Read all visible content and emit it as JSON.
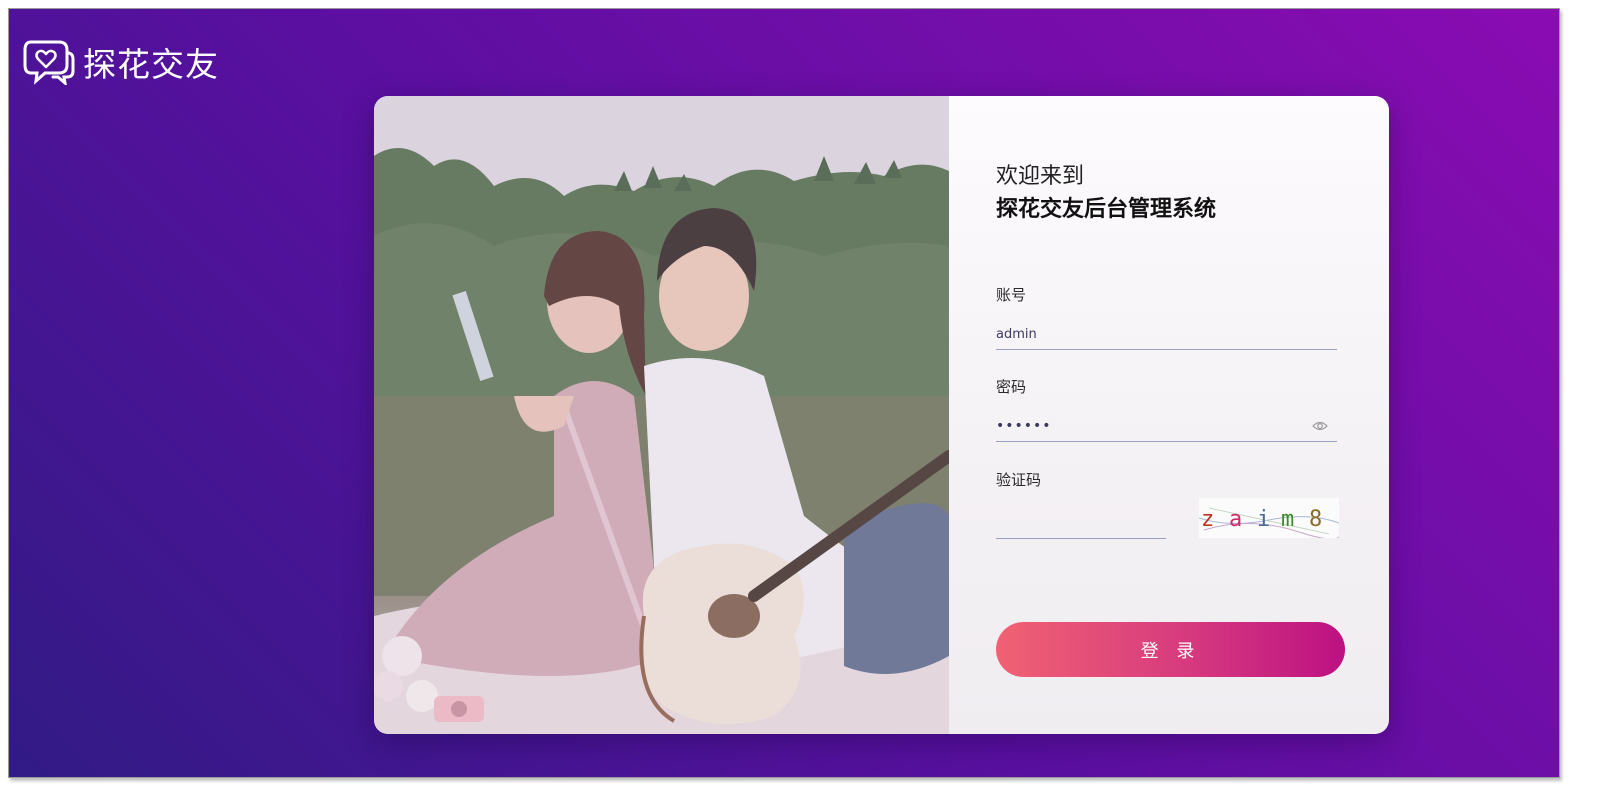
{
  "brand": {
    "name": "探花交友",
    "logo_icon": "chat-heart-icon"
  },
  "login": {
    "welcome": "欢迎来到",
    "system_title": "探花交友后台管理系统",
    "username_label": "账号",
    "username_value": "admin",
    "password_label": "密码",
    "password_value": "••••••",
    "password_toggle_icon": "eye-icon",
    "captcha_label": "验证码",
    "captcha_value": "",
    "captcha_text": "zaim8",
    "submit_label": "登 录"
  },
  "colors": {
    "bg_start": "#311b85",
    "bg_end": "#8a0cb2",
    "button_start": "#f06273",
    "button_end": "#bc1182"
  }
}
